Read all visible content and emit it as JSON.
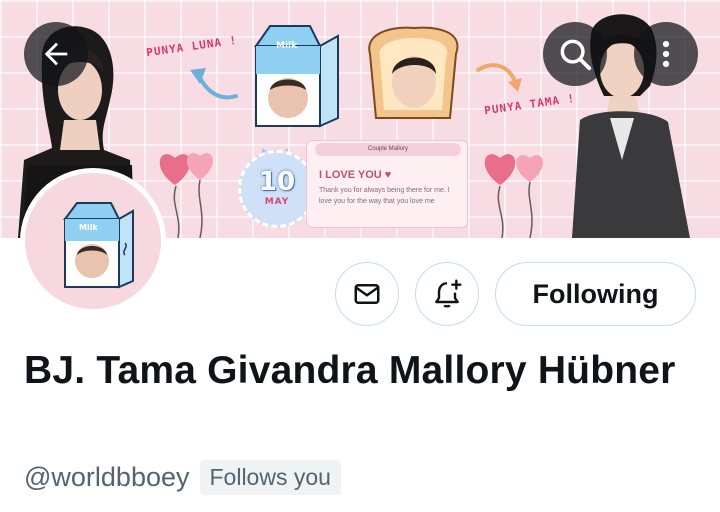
{
  "header": {
    "back_icon": "arrow-left-icon",
    "search_icon": "search-icon",
    "more_icon": "more-vertical-icon"
  },
  "banner": {
    "label_left": "PUNYA LUNA !",
    "label_right": "PUNYA TAMA !",
    "milk_label": "Milk",
    "date_day": "10",
    "date_month": "MAY",
    "note_tab": "Couple Mallory",
    "note_heading": "I LOVE YOU ♥",
    "note_body": "Thank you for always being there for me. I love you for the way that you love me"
  },
  "avatar": {
    "milk_label": "Milk"
  },
  "actions": {
    "message_icon": "envelope-icon",
    "notify_icon": "bell-plus-icon",
    "follow_label": "Following"
  },
  "profile": {
    "display_name": "BJ. Tama Givandra Mallory Hübner",
    "handle": "@worldbboey",
    "follows_you": "Follows you"
  },
  "colors": {
    "banner_bg": "#f7dde3",
    "overlay_button": "#0f1419",
    "text_primary": "#0f1419",
    "text_secondary": "#536471",
    "border": "#cfd9de"
  }
}
